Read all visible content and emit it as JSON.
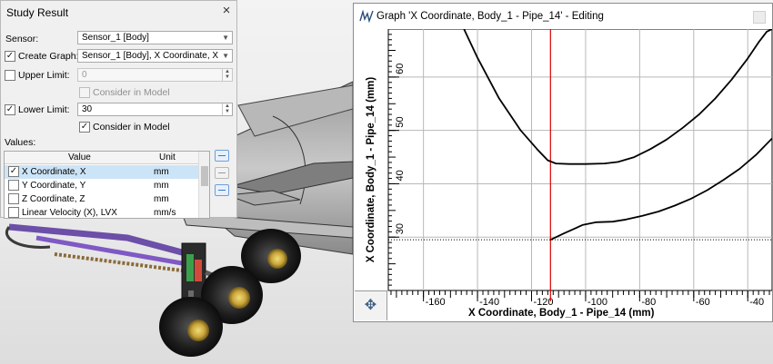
{
  "study": {
    "title": "Study Result",
    "close_icon": "×",
    "sensor_label": "Sensor:",
    "sensor_value": "Sensor_1 [Body]",
    "create_graph_label": "Create Graph:",
    "create_graph_checked": true,
    "create_graph_value": "Sensor_1 [Body], X Coordinate, X",
    "upper_limit_label": "Upper Limit:",
    "upper_limit_checked": false,
    "upper_limit_value": "0",
    "upper_consider_label": "Consider in Model",
    "upper_consider_checked": false,
    "lower_limit_label": "Lower Limit:",
    "lower_limit_checked": true,
    "lower_limit_value": "30",
    "lower_consider_label": "Consider in Model",
    "lower_consider_checked": true,
    "values_label": "Values:",
    "columns": {
      "value": "Value",
      "unit": "Unit"
    },
    "rows": [
      {
        "name": "X Coordinate, X",
        "unit": "mm",
        "checked": true,
        "selected": true
      },
      {
        "name": "Y Coordinate, Y",
        "unit": "mm",
        "checked": false,
        "selected": false
      },
      {
        "name": "Z Coordinate, Z",
        "unit": "mm",
        "checked": false,
        "selected": false
      },
      {
        "name": "Linear Velocity (X), LVX",
        "unit": "mm/s",
        "checked": false,
        "selected": false
      }
    ]
  },
  "graph": {
    "title": "Graph 'X Coordinate, Body_1 - Pipe_14' - Editing",
    "move_icon": "✥",
    "x_axis_title": "X Coordinate, Body_1 - Pipe_14 (mm)",
    "y_axis_title": "X Coordinate, Body_1 - Pipe_14 (mm)"
  },
  "chart_data": {
    "type": "line",
    "x_tick_labels": [
      "-160",
      "-140",
      "-120",
      "-100",
      "-80",
      "-60",
      "-40"
    ],
    "y_tick_labels": [
      "30",
      "40",
      "50",
      "60"
    ],
    "xlim": [
      -173,
      -31
    ],
    "ylim": [
      20,
      69
    ],
    "grid": true,
    "series": [
      {
        "values_x": [
          -145,
          -140,
          -132,
          -124,
          -118,
          -114,
          -111,
          -106,
          -100,
          -93,
          -88,
          -82,
          -76,
          -70,
          -64,
          -58,
          -52,
          -46,
          -40,
          -36,
          -33,
          -31
        ],
        "values_y": [
          69,
          63.6,
          56,
          50,
          46.5,
          44.4,
          43.8,
          43.7,
          43.7,
          43.8,
          44.1,
          45,
          46.5,
          48.3,
          50.5,
          53,
          56,
          59.5,
          63.5,
          66.5,
          68.5,
          69
        ]
      },
      {
        "values_x": [
          -113,
          -108,
          -101,
          -96,
          -90,
          -85,
          -79,
          -73,
          -67,
          -61,
          -55,
          -49,
          -43,
          -37,
          -31
        ],
        "values_y": [
          29.5,
          30.7,
          32.3,
          32.8,
          32.9,
          33.3,
          34.0,
          34.8,
          35.9,
          37.2,
          38.8,
          40.7,
          42.8,
          45.4,
          48.5
        ]
      }
    ],
    "reference_lines": [
      {
        "axis": "x",
        "value": -113,
        "color": "#d80000"
      },
      {
        "axis": "y",
        "value": 29.5,
        "color": "#000000",
        "style": "dotted"
      }
    ]
  }
}
